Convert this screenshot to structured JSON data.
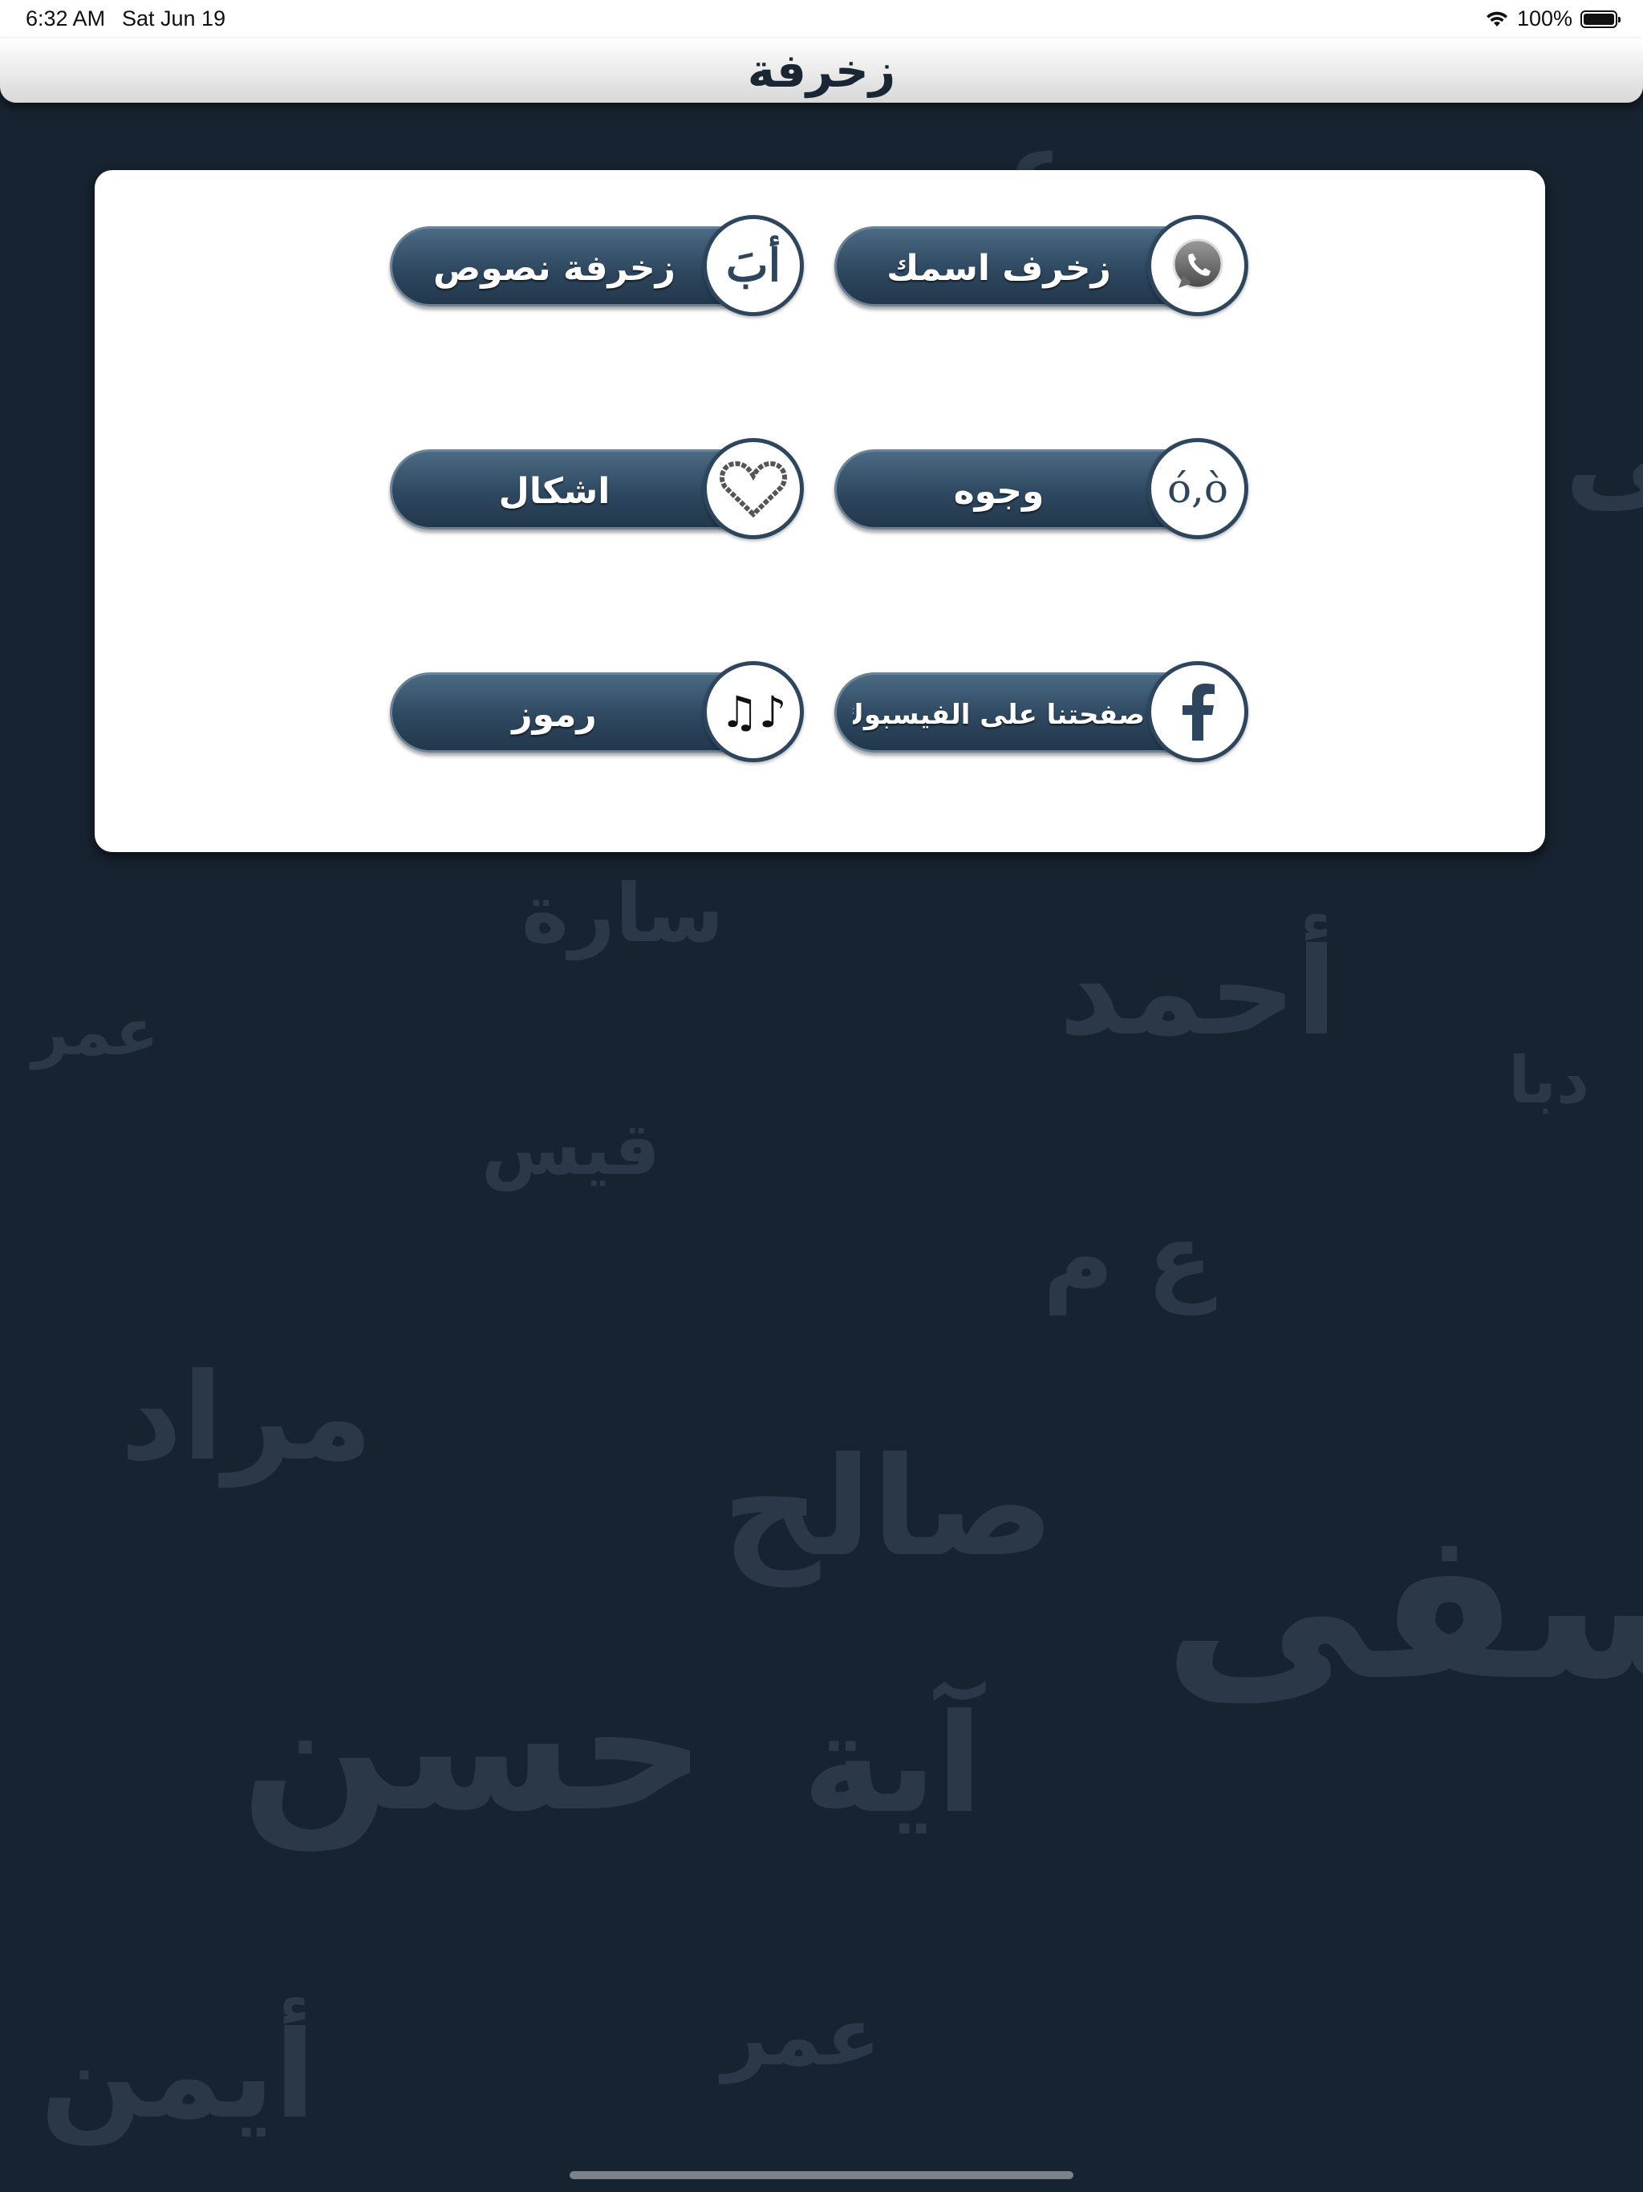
{
  "status_bar": {
    "time": "6:32 AM",
    "date": "Sat Jun 19",
    "battery": "100%",
    "battery_level": 1.0
  },
  "nav": {
    "title": "زخرفة"
  },
  "menu": {
    "items": [
      {
        "label": "زخرف اسمك",
        "icon": "whatsapp-icon"
      },
      {
        "label": "زخرفة نصوص",
        "icon": "arabic-letters-icon",
        "icon_text": "أبَ"
      },
      {
        "label": "وجوه",
        "icon": "face-icon",
        "icon_text": "ó,ò"
      },
      {
        "label": "اشكال",
        "icon": "heart-icon"
      },
      {
        "label": "صفحتنا على الفيسبوك",
        "icon": "facebook-icon"
      },
      {
        "label": "رموز",
        "icon": "music-notes-icon",
        "icon_text": "♫♪"
      }
    ]
  },
  "colors": {
    "background": "#172330",
    "button_top": "#4b6a84",
    "button_bottom": "#22374b",
    "circle_border": "#2d465d",
    "card": "#ffffff"
  }
}
